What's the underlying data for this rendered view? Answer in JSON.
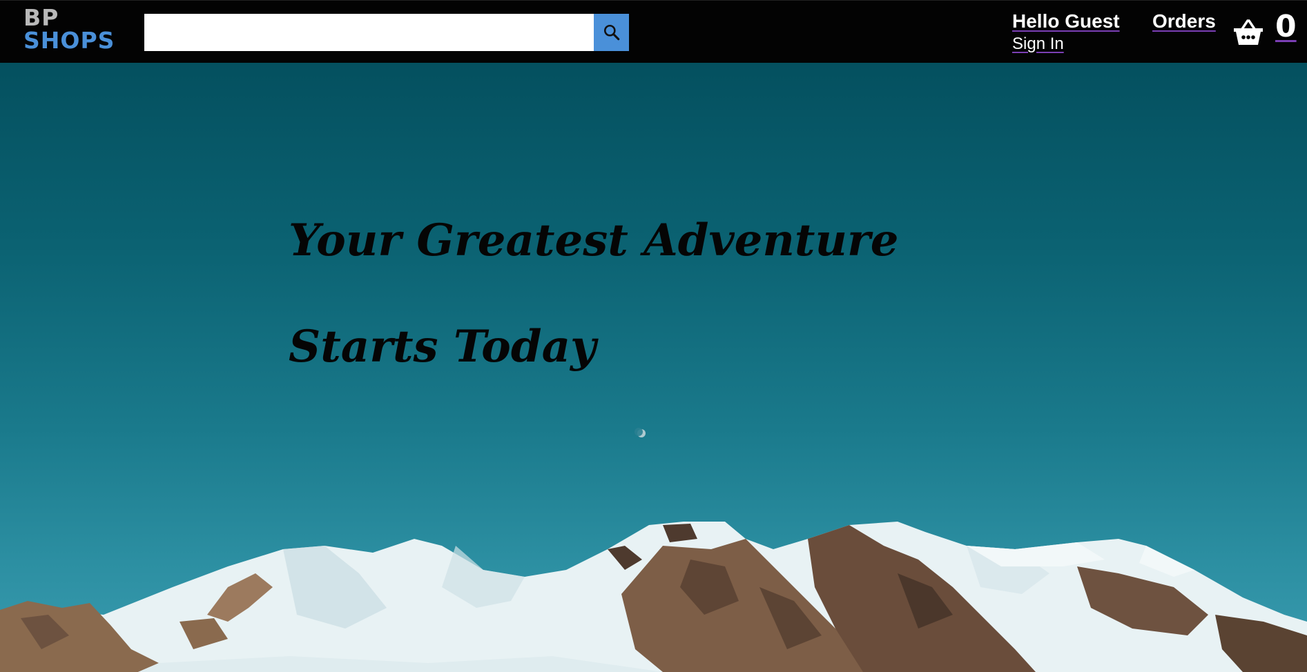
{
  "header": {
    "logo": {
      "line1": "BP",
      "line2": "SHOPS"
    },
    "search": {
      "value": "",
      "placeholder": "",
      "button_icon": "search-icon"
    },
    "account": {
      "greeting": "Hello Guest",
      "sign_in": "Sign In"
    },
    "orders_label": "Orders",
    "cart": {
      "icon": "basket-icon",
      "count": "0"
    }
  },
  "hero": {
    "headline_line1": "Your Greatest Adventure",
    "headline_line2": "Starts Today",
    "background": "mountain-sky-image"
  },
  "colors": {
    "navbar": "#030303",
    "accent_blue": "#4a90d9",
    "underline_purple": "#7b3fb5",
    "sky": "#0b6272"
  }
}
